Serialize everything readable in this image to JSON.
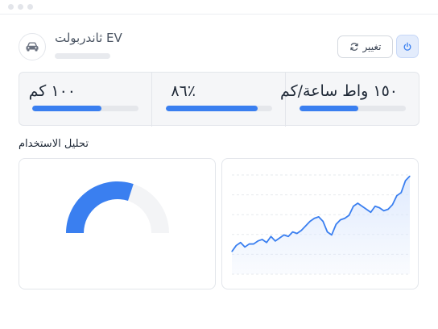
{
  "header": {
    "vehicle_name": "ثاندربولت EV",
    "vehicle_icon": "car-icon",
    "change_label": "تغيير",
    "change_icon": "refresh-icon",
    "power_icon": "power-icon"
  },
  "stats": [
    {
      "value": "١٥٠ واط ساعة/كم",
      "progress": 0.55
    },
    {
      "value": "٨٦٪",
      "progress": 0.86
    },
    {
      "value": "١٠٠ كم",
      "progress": 0.65
    }
  ],
  "analysis": {
    "title": "تحليل الاستخدام"
  },
  "chart_data": [
    {
      "type": "gauge",
      "value": 0.6,
      "colors": {
        "fill": "#3a7ff0",
        "track": "#f3f4f6"
      }
    },
    {
      "type": "area",
      "values": [
        45,
        49,
        51,
        48,
        50,
        50,
        52,
        53,
        51,
        55,
        52,
        54,
        56,
        55,
        58,
        57,
        59,
        62,
        65,
        67,
        68,
        65,
        58,
        56,
        63,
        66,
        67,
        69,
        75,
        77,
        75,
        73,
        71,
        75,
        74,
        72,
        73,
        76,
        82,
        84,
        92,
        95
      ],
      "grid": true,
      "colors": {
        "line": "#3a7ff0",
        "fill": "#dce8fd"
      }
    }
  ],
  "colors": {
    "accent": "#3a7ff0",
    "track": "#e5e7eb",
    "panel": "#f5f6f8"
  }
}
